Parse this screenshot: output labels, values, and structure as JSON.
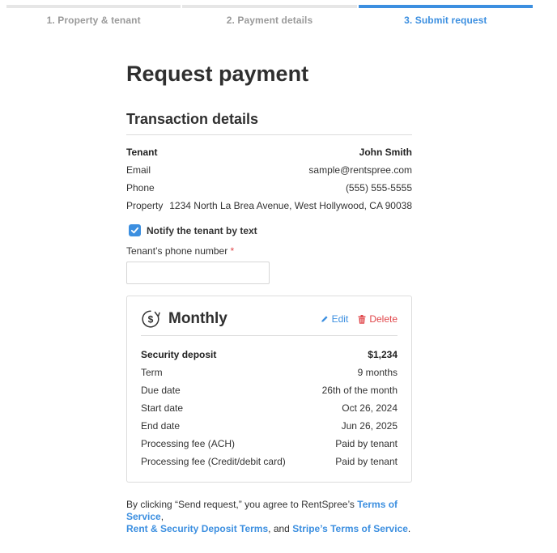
{
  "stepper": {
    "steps": [
      {
        "label": "1. Property & tenant",
        "active": false
      },
      {
        "label": "2. Payment details",
        "active": false
      },
      {
        "label": "3. Submit request",
        "active": true
      }
    ]
  },
  "page": {
    "title": "Request payment",
    "section_title": "Transaction details"
  },
  "tenant": {
    "tenant_label": "Tenant",
    "tenant_value": "John Smith",
    "email_label": "Email",
    "email_value": "sample@rentspree.com",
    "phone_label": "Phone",
    "phone_value": "(555) 555-5555",
    "property_label": "Property",
    "property_value": "1234 North La Brea Avenue, West Hollywood, CA 90038"
  },
  "notify": {
    "label": "Notify the tenant by text",
    "checked": true
  },
  "phone_field": {
    "label": "Tenant’s phone number",
    "required_mark": "*",
    "value": ""
  },
  "payment_card": {
    "icon": "recurring-dollar-icon",
    "title": "Monthly",
    "edit_label": "Edit",
    "delete_label": "Delete",
    "rows": [
      {
        "label": "Security deposit",
        "value": "$1,234"
      },
      {
        "label": "Term",
        "value": "9 months"
      },
      {
        "label": "Due date",
        "value": "26th of the month"
      },
      {
        "label": "Start date",
        "value": "Oct 26, 2024"
      },
      {
        "label": "End date",
        "value": "Jun 26, 2025"
      },
      {
        "label": "Processing fee (ACH)",
        "value": "Paid by tenant"
      },
      {
        "label": "Processing fee (Credit/debit card)",
        "value": "Paid by tenant"
      }
    ]
  },
  "terms": {
    "prefix": "By clicking “Send request,” you agree to RentSpree’s ",
    "tos_link": "Terms of Service",
    "sep1": ",",
    "deposit_link": "Rent & Security Deposit Terms",
    "sep2": ", and ",
    "stripe_link": "Stripe’s Terms of Service",
    "suffix": "."
  },
  "colors": {
    "accent": "#3c8fe0",
    "danger": "#e0464a",
    "text": "#333333",
    "muted": "#9a9a9a",
    "border": "#dcdcdc"
  }
}
